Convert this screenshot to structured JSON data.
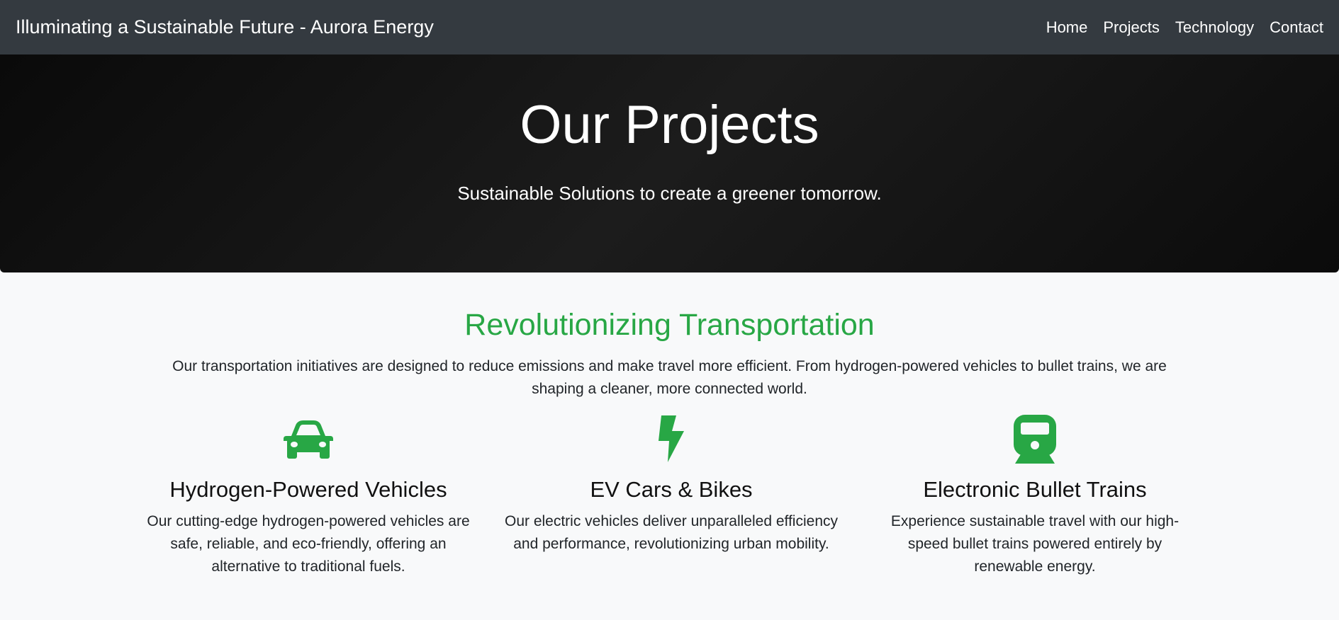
{
  "navbar": {
    "brand": "Illuminating a Sustainable Future - Aurora Energy",
    "links": [
      "Home",
      "Projects",
      "Technology",
      "Contact"
    ]
  },
  "hero": {
    "title": "Our Projects",
    "subtitle": "Sustainable Solutions to create a greener tomorrow."
  },
  "section": {
    "title": "Revolutionizing Transportation",
    "description": "Our transportation initiatives are designed to reduce emissions and make travel more efficient. From hydrogen-powered vehicles to bullet trains, we are shaping a cleaner, more connected world.",
    "cards": [
      {
        "icon": "car-icon",
        "title": "Hydrogen-Powered Vehicles",
        "text": "Our cutting-edge hydrogen-powered vehicles are safe, reliable, and eco-friendly, offering an alternative to traditional fuels."
      },
      {
        "icon": "bolt-icon",
        "title": "EV Cars & Bikes",
        "text": "Our electric vehicles deliver unparalleled efficiency and performance, revolutionizing urban mobility."
      },
      {
        "icon": "train-icon",
        "title": "Electronic Bullet Trains",
        "text": "Experience sustainable travel with our high-speed bullet trains powered entirely by renewable energy."
      }
    ]
  },
  "colors": {
    "navbar_bg": "#343a40",
    "accent_green": "#28a745",
    "hero_bg": "#121212",
    "page_bg": "#f8f9fa"
  }
}
